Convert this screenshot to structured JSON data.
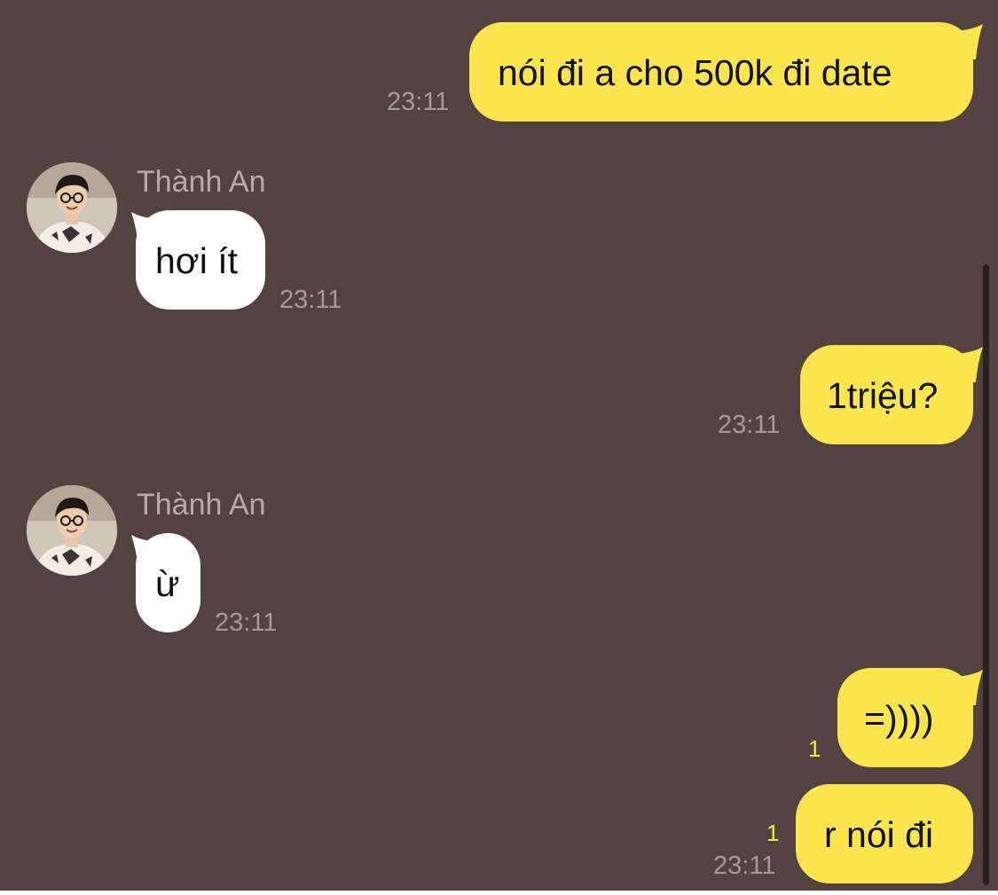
{
  "colors": {
    "background": "#524240",
    "outgoing_bubble": "#FAE54E",
    "incoming_bubble": "#FFFFFF",
    "timestamp": "#A89B98",
    "sender_name": "#B8ACA9",
    "unread_count": "#FAE54E"
  },
  "messages": [
    {
      "direction": "outgoing",
      "text": "nói đi a cho 500k đi date",
      "time": "23:11"
    },
    {
      "direction": "incoming",
      "sender": "Thành An",
      "avatar_icon": "profile-photo-icon",
      "text": "hơi ít",
      "time": "23:11"
    },
    {
      "direction": "outgoing",
      "text": "1triệu?",
      "time": "23:11"
    },
    {
      "direction": "incoming",
      "sender": "Thành An",
      "avatar_icon": "profile-photo-icon",
      "text": "ừ",
      "time": "23:11"
    },
    {
      "direction": "outgoing",
      "text": "=))))",
      "unread": "1"
    },
    {
      "direction": "outgoing",
      "text": "r nói đi",
      "unread": "1",
      "time": "23:11"
    }
  ]
}
